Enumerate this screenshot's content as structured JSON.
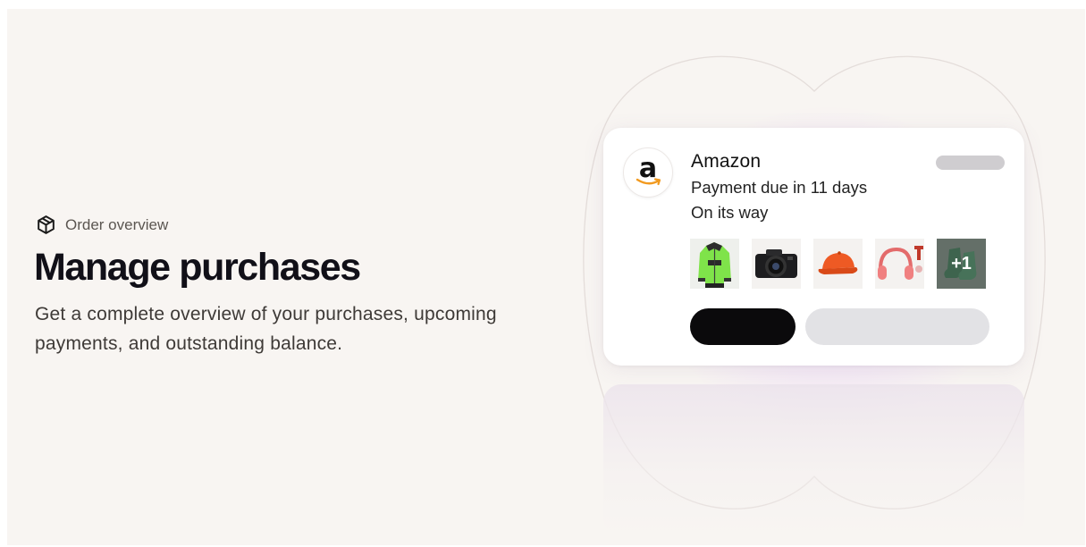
{
  "hero": {
    "eyebrow": "Order overview",
    "eyebrow_icon": "box-icon",
    "title": "Manage purchases",
    "description": "Get a complete overview of your purchases, upcoming payments, and outstanding balance."
  },
  "order_card": {
    "merchant_logo_icon": "amazon-logo",
    "merchant_logo_letter": "a",
    "merchant": "Amazon",
    "payment_status": "Payment due in 11 days",
    "shipping_status": "On its way",
    "items": [
      {
        "name": "green-jacket",
        "icon": "jacket-thumbnail"
      },
      {
        "name": "camera",
        "icon": "camera-thumbnail"
      },
      {
        "name": "orange-cap",
        "icon": "cap-thumbnail"
      },
      {
        "name": "headphones",
        "icon": "headphones-thumbnail"
      }
    ],
    "more_items_label": "+1"
  },
  "colors": {
    "background": "#f8f5f2",
    "primary_button": "#0b0a0c",
    "secondary_button": "#e2e2e5",
    "glow": "#e6c9f5"
  }
}
